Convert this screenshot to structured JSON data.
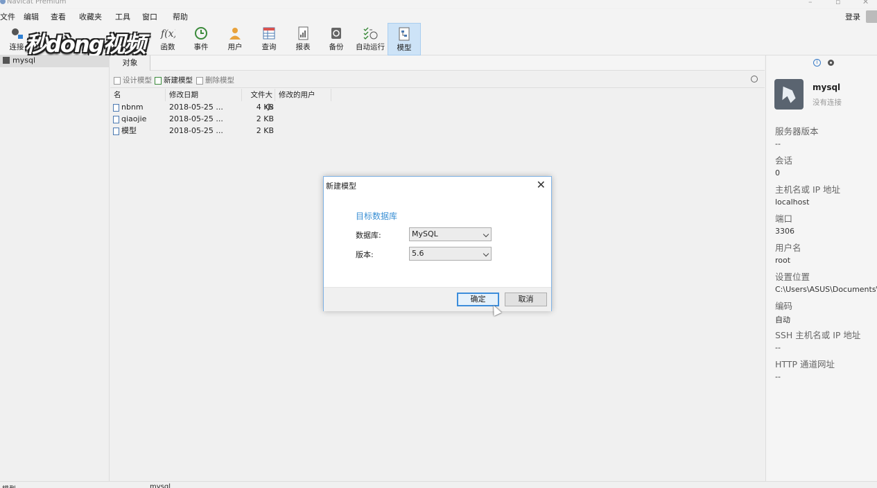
{
  "window": {
    "title": "Navicat Premium",
    "login_label": "登录"
  },
  "menu": [
    "文件",
    "编辑",
    "查看",
    "收藏夹",
    "工具",
    "窗口",
    "帮助"
  ],
  "toolbar": {
    "items": [
      {
        "label": "连接",
        "icon": "connection-icon"
      },
      {
        "label": "函数",
        "icon": "function-icon"
      },
      {
        "label": "事件",
        "icon": "event-clock-icon"
      },
      {
        "label": "用户",
        "icon": "user-icon"
      },
      {
        "label": "查询",
        "icon": "query-table-icon"
      },
      {
        "label": "报表",
        "icon": "report-icon"
      },
      {
        "label": "备份",
        "icon": "backup-icon"
      },
      {
        "label": "自动运行",
        "icon": "schedule-icon"
      },
      {
        "label": "模型",
        "icon": "model-icon",
        "active": true
      }
    ],
    "watermark": "秒dòng视频"
  },
  "nav": {
    "connection": "mysql"
  },
  "main": {
    "tab": "对象",
    "actions": {
      "design": "设计模型",
      "new": "新建模型",
      "delete": "删除模型"
    },
    "columns": [
      "名",
      "修改日期",
      "文件大小",
      "修改的用户"
    ],
    "rows": [
      {
        "name": "nbnm",
        "date": "2018-05-25 ...",
        "size": "4 KB"
      },
      {
        "name": "qiaojie",
        "date": "2018-05-25 ...",
        "size": "2 KB"
      },
      {
        "name": "模型",
        "date": "2018-05-25 ...",
        "size": "2 KB"
      }
    ]
  },
  "info": {
    "name": "mysql",
    "status": "没有连接",
    "fields": [
      {
        "label": "服务器版本",
        "value": "--"
      },
      {
        "label": "会话",
        "value": "0"
      },
      {
        "label": "主机名或 IP 地址",
        "value": "localhost"
      },
      {
        "label": "端口",
        "value": "3306"
      },
      {
        "label": "用户名",
        "value": "root"
      },
      {
        "label": "设置位置",
        "value": "C:\\Users\\ASUS\\Documents\\Na"
      },
      {
        "label": "编码",
        "value": "自动"
      },
      {
        "label": "SSH 主机名或 IP 地址",
        "value": "--"
      },
      {
        "label": "HTTP 通道网址",
        "value": "--"
      }
    ]
  },
  "dialog": {
    "title": "新建模型",
    "section": "目标数据库",
    "db_label": "数据库:",
    "db_value": "MySQL",
    "version_label": "版本:",
    "version_value": "5.6",
    "ok": "确定",
    "cancel": "取消"
  },
  "statusbar": {
    "left": "模型",
    "connection": "mysql"
  },
  "colors": {
    "accent": "#3a8fd4",
    "active_tool_bg": "#cde3f7"
  }
}
